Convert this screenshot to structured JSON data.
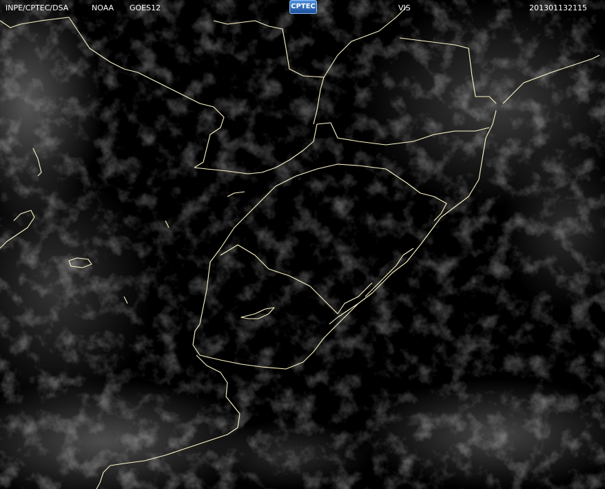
{
  "header": {
    "agency": "INPE/CPTEC/DSA",
    "source": "NOAA",
    "satellite": "GOES12",
    "logo_text": "CPTEC",
    "channel": "VIS",
    "timestamp": "201301132115"
  },
  "colors": {
    "background": "#000000",
    "coastline": "#fff7c8",
    "header_text": "#ffffff",
    "cloud": "#c8c8c8"
  }
}
